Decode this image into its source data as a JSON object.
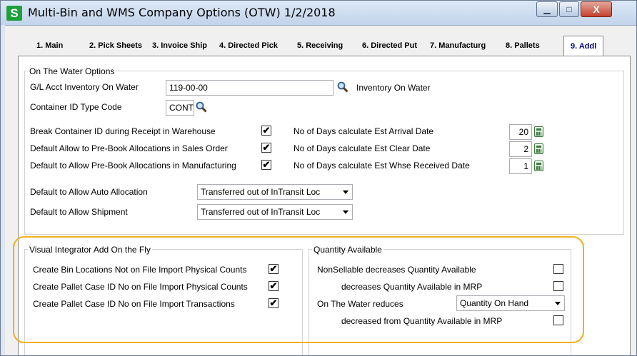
{
  "window": {
    "icon_letter": "S",
    "title": "Multi-Bin and WMS Company Options (OTW) 1/2/2018",
    "minimize_glyph": "▁",
    "maximize_glyph": "□",
    "close_glyph": "X"
  },
  "tabs": [
    {
      "label": "1. Main"
    },
    {
      "label": "2. Pick Sheets"
    },
    {
      "label": "3. Invoice Ship"
    },
    {
      "label": "4. Directed Pick"
    },
    {
      "label": "5. Receiving"
    },
    {
      "label": "6. Directed Put"
    },
    {
      "label": "7. Manufacturg"
    },
    {
      "label": "8. Pallets"
    },
    {
      "label": "9. Addl",
      "active": true
    }
  ],
  "otw": {
    "title": "On The Water Options",
    "gl_label": "G/L Acct Inventory On Water",
    "gl_value": "119-00-00",
    "gl_desc": "Inventory On Water",
    "container_label": "Container ID Type Code",
    "container_value": "CONT",
    "break_label": "Break Container ID during Receipt in Warehouse",
    "break_checked": true,
    "prebook_so_label": "Default Allow to Pre-Book Allocations in Sales Order",
    "prebook_so_checked": true,
    "prebook_mfg_label": "Default to Allow Pre-Book Allocations in Manufacturing",
    "prebook_mfg_checked": true,
    "days_arrival_label": "No of Days calculate Est Arrival Date",
    "days_arrival_value": "20",
    "days_clear_label": "No of Days calculate Est Clear Date",
    "days_clear_value": "2",
    "days_whse_label": "No of Days calculate Est Whse Received Date",
    "days_whse_value": "1",
    "auto_alloc_label": "Default to Allow Auto Allocation",
    "auto_alloc_value": "Transferred out of InTransit Loc",
    "shipment_label": "Default to Allow Shipment",
    "shipment_value": "Transferred out of InTransit Loc"
  },
  "vi": {
    "title": "Visual Integrator Add On the Fly",
    "bin_label": "Create Bin Locations Not on File Import Physical Counts",
    "bin_checked": true,
    "pallet_pc_label": "Create Pallet Case ID No on File Import Physical Counts",
    "pallet_pc_checked": true,
    "pallet_tx_label": "Create Pallet Case ID No on File Import Transactions",
    "pallet_tx_checked": true
  },
  "qty": {
    "title": "Quantity Available",
    "nonsellable_label": "NonSellable decreases Quantity Available",
    "nonsellable_checked": false,
    "mrp_label": "decreases Quantity Available in MRP",
    "mrp_checked": false,
    "otw_reduces_label": "On The Water reduces",
    "otw_reduces_value": "Quantity On Hand",
    "otw_mrp_label": "decreased from Quantity Available in MRP",
    "otw_mrp_checked": false
  },
  "colors": {
    "highlight": "#f0b020",
    "active_tab_text": "#00008b",
    "app_icon": "#1ea03a"
  }
}
